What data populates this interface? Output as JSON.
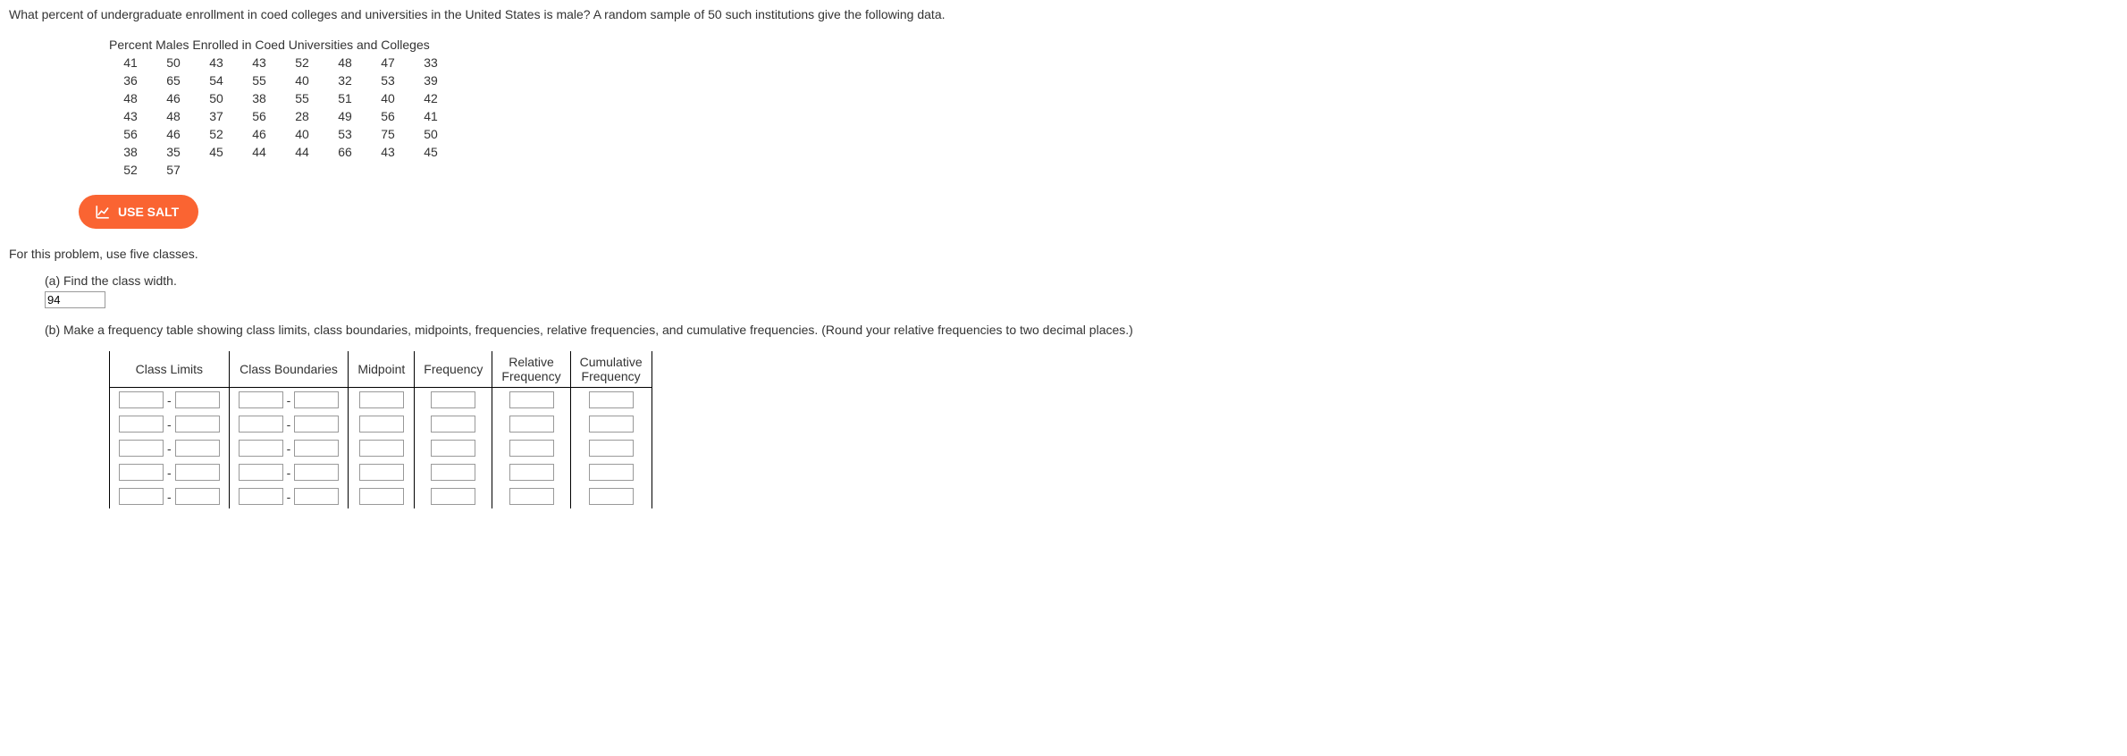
{
  "question": "What percent of undergraduate enrollment in coed colleges and universities in the United States is male? A random sample of 50 such institutions give the following data.",
  "data_title": "Percent Males Enrolled in Coed Universities and Colleges",
  "data_rows": [
    [
      "41",
      "50",
      "43",
      "43",
      "52",
      "48",
      "47",
      "33"
    ],
    [
      "36",
      "65",
      "54",
      "55",
      "40",
      "32",
      "53",
      "39"
    ],
    [
      "48",
      "46",
      "50",
      "38",
      "55",
      "51",
      "40",
      "42"
    ],
    [
      "43",
      "48",
      "37",
      "56",
      "28",
      "49",
      "56",
      "41"
    ],
    [
      "56",
      "46",
      "52",
      "46",
      "40",
      "53",
      "75",
      "50"
    ],
    [
      "38",
      "35",
      "45",
      "44",
      "44",
      "66",
      "43",
      "45"
    ],
    [
      "52",
      "57",
      "",
      "",
      "",
      "",
      "",
      ""
    ]
  ],
  "salt_label": "USE SALT",
  "instruction": "For this problem, use five classes.",
  "part_a": {
    "label": "(a) Find the class width.",
    "value": "94"
  },
  "part_b": {
    "label": "(b) Make a frequency table showing class limits, class boundaries, midpoints, frequencies, relative frequencies, and cumulative frequencies. (Round your relative frequencies to two decimal places.)"
  },
  "headers": {
    "class_limits": "Class Limits",
    "class_boundaries": "Class Boundaries",
    "midpoint": "Midpoint",
    "frequency": "Frequency",
    "rel_freq_1": "Relative",
    "rel_freq_2": "Frequency",
    "cum_freq_1": "Cumulative",
    "cum_freq_2": "Frequency"
  },
  "dash": "-",
  "num_rows": 5
}
